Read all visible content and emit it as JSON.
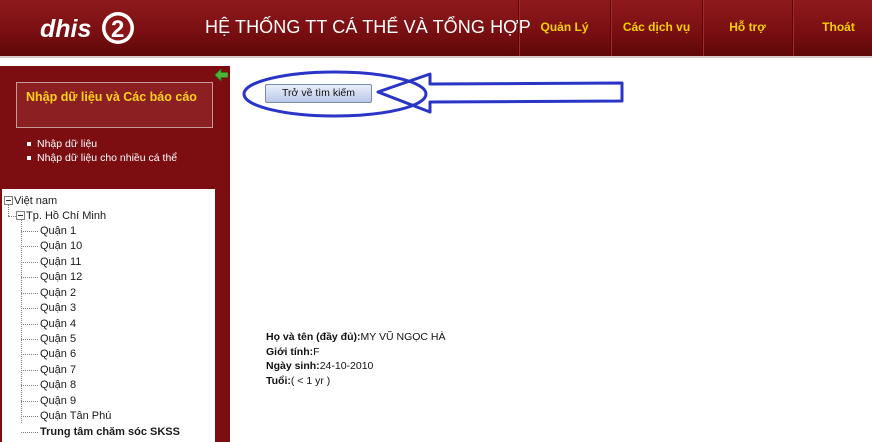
{
  "header": {
    "logo_text": "DHIS 2",
    "title": "HỆ THỐNG TT CÁ THỂ VÀ TỔNG HỢP",
    "nav": [
      {
        "label": "Quản Lý"
      },
      {
        "label": "Các dịch vụ"
      },
      {
        "label": "Hỗ trợ"
      },
      {
        "label": "Thoát"
      }
    ]
  },
  "sidebar": {
    "menu_title": "Nhập dữ liệu và Các báo cáo",
    "links": [
      {
        "label": "Nhập dữ liệu"
      },
      {
        "label": "Nhập dữ liệu cho nhiều cá thể"
      }
    ],
    "tree": {
      "root": "Việt nam",
      "city": "Tp. Hồ Chí Minh",
      "children": [
        "Quận 1",
        "Quận 10",
        "Quận 11",
        "Quận 12",
        "Quận 2",
        "Quận 3",
        "Quận 4",
        "Quận 5",
        "Quận 6",
        "Quận 7",
        "Quận 8",
        "Quận 9",
        "Quận Tân Phú",
        "Trung tâm chăm sóc SKSS"
      ],
      "selected": "Trung tâm chăm sóc SKSS"
    }
  },
  "main": {
    "back_button_label": "Trở về tìm kiếm",
    "person": {
      "name_label": "Họ và tên (đầy đủ):",
      "name_value": "MY VŨ NGỌC HÀ",
      "gender_label": "Giới tính:",
      "gender_value": "F",
      "dob_label": "Ngày sinh:",
      "dob_value": "24-10-2010",
      "age_label": "Tuổi:",
      "age_value": "( < 1 yr )"
    }
  },
  "colors": {
    "header_bg": "#7a0f12",
    "nav_text": "#f5d000",
    "menu_title": "#ffd21a",
    "annotation": "#2a35c8"
  },
  "icons": {
    "collapse": "green-left-arrow-icon",
    "tree_toggle": "minus-box-icon"
  }
}
